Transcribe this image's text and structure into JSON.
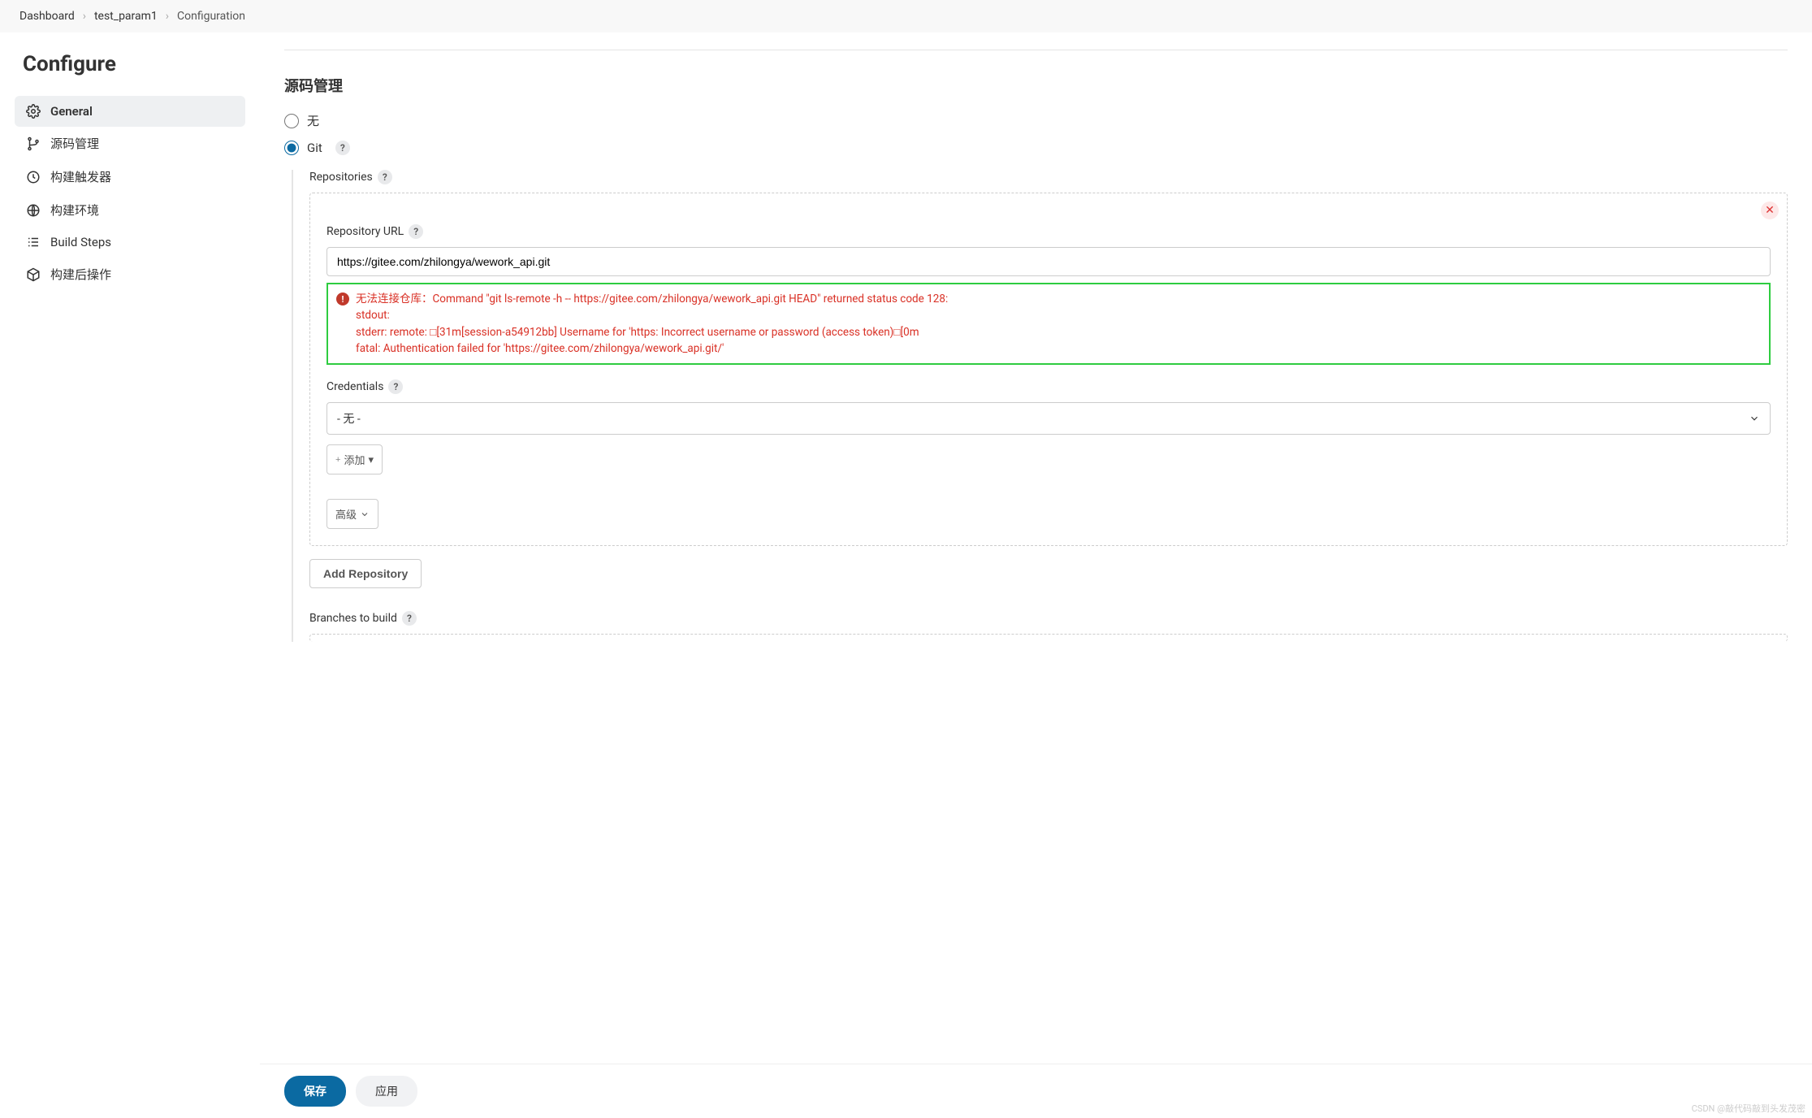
{
  "breadcrumb": {
    "items": [
      "Dashboard",
      "test_param1",
      "Configuration"
    ]
  },
  "sidebar": {
    "title": "Configure",
    "items": [
      {
        "label": "General"
      },
      {
        "label": "源码管理"
      },
      {
        "label": "构建触发器"
      },
      {
        "label": "构建环境"
      },
      {
        "label": "Build Steps"
      },
      {
        "label": "构建后操作"
      }
    ]
  },
  "scm": {
    "section_title": "源码管理",
    "radio_none": "无",
    "radio_git": "Git",
    "repositories_label": "Repositories",
    "repo_url_label": "Repository URL",
    "repo_url_value": "https://gitee.com/zhilongya/wework_api.git",
    "error_line1": "无法连接仓库：Command \"git ls-remote -h -- https://gitee.com/zhilongya/wework_api.git HEAD\" returned status code 128:",
    "error_line2": "stdout:",
    "error_line3": "stderr: remote: □[31m[session-a54912bb] Username for 'https: Incorrect username or password (access token)□[0m",
    "error_line4": "fatal: Authentication failed for 'https://gitee.com/zhilongya/wework_api.git/'",
    "credentials_label": "Credentials",
    "credentials_value": "- 无 -",
    "add_small": "添加",
    "advanced": "高级",
    "add_repo": "Add Repository",
    "branches_label": "Branches to build"
  },
  "footer": {
    "save": "保存",
    "apply": "应用"
  },
  "watermark": "CSDN @敲代码敲到头发茂密"
}
